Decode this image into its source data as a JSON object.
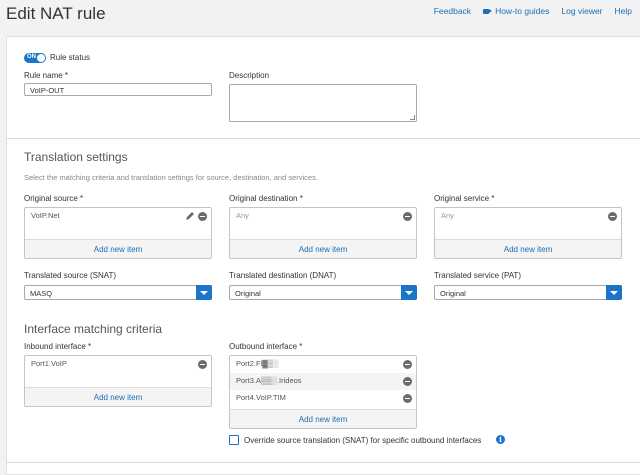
{
  "header": {
    "title": "Edit NAT rule",
    "links": {
      "feedback": "Feedback",
      "howto": "How-to guides",
      "logviewer": "Log viewer",
      "help": "Help"
    }
  },
  "rule": {
    "status_label": "Rule status",
    "toggle_text": "ON",
    "name_label": "Rule name *",
    "name_value": "VoIP-OUT",
    "description_label": "Description"
  },
  "translation": {
    "title": "Translation settings",
    "desc": "Select the matching criteria and translation settings for source, destination, and services.",
    "orig_source_label": "Original source *",
    "orig_source_items": [
      "VoIP.Net"
    ],
    "orig_dest_label": "Original destination *",
    "orig_dest_value": "Any",
    "orig_service_label": "Original service *",
    "orig_service_value": "Any",
    "add_new": "Add new item",
    "snat_label": "Translated source (SNAT)",
    "snat_value": "MASQ",
    "dnat_label": "Translated destination (DNAT)",
    "dnat_value": "Original",
    "pat_label": "Translated service (PAT)",
    "pat_value": "Original"
  },
  "interface": {
    "title": "Interface matching criteria",
    "inbound_label": "Inbound interface *",
    "inbound_items": [
      "Port1.VoIP"
    ],
    "outbound_label": "Outbound interface *",
    "outbound_items": [
      "Port2.Fl▓▒░",
      "Port3.A▒▒░.Irideos",
      "Port4.VoIP.TIM"
    ],
    "add_new": "Add new item",
    "override_label": "Override source translation (SNAT) for specific outbound interfaces"
  }
}
